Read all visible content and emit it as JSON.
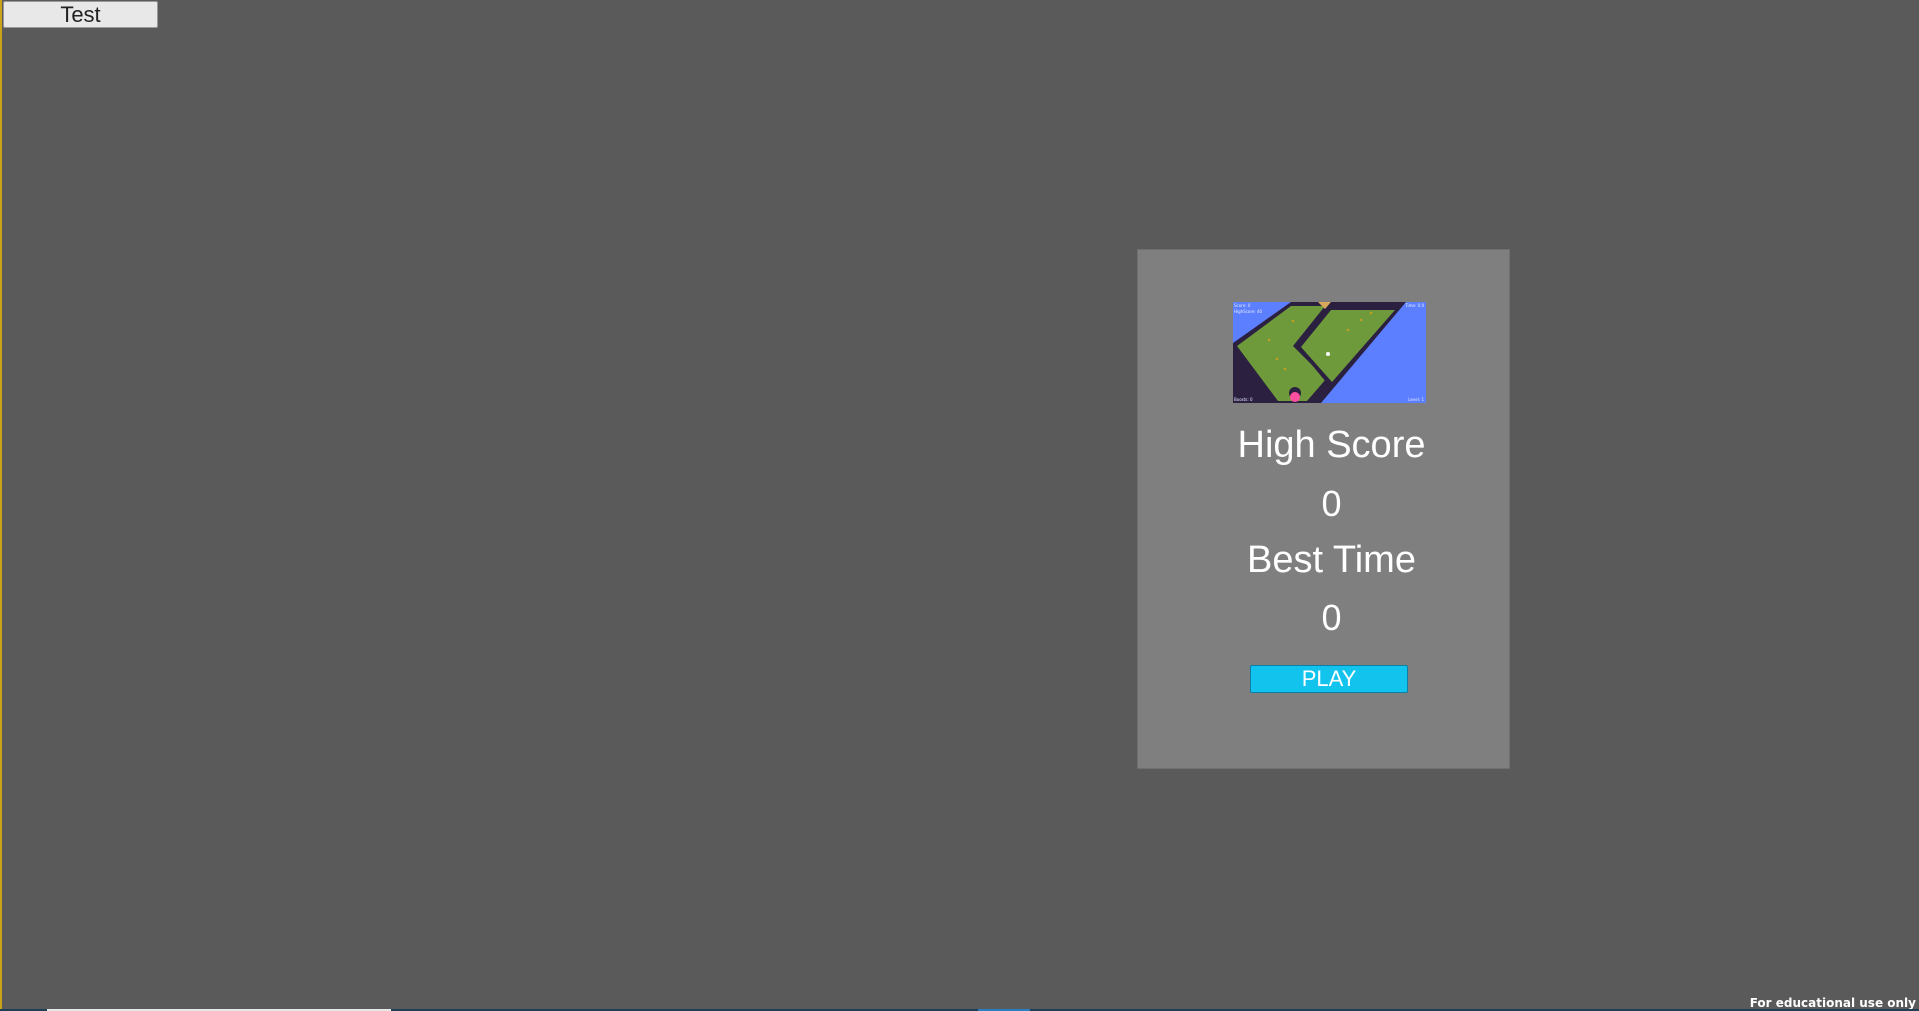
{
  "toolbar": {
    "test_label": "Test"
  },
  "menu": {
    "preview": {
      "icon": "game-preview-image",
      "hud_top_left_1": "Score: 0",
      "hud_top_left_2": "HighScore: 40",
      "hud_top_right": "Time: 0.0",
      "hud_bottom_left": "Boosts: 0",
      "hud_bottom_right": "Level: 1"
    },
    "high_score_label": "High Score",
    "high_score_value": "0",
    "best_time_label": "Best Time",
    "best_time_value": "0",
    "play_label": "PLAY"
  },
  "footer": {
    "note": "For educational use only"
  },
  "colors": {
    "background": "#5a5a5a",
    "panel": "#7f7f7f",
    "play_button": "#12c3ee",
    "preview_water": "#5b7fff",
    "preview_grass": "#6f9a3c"
  }
}
